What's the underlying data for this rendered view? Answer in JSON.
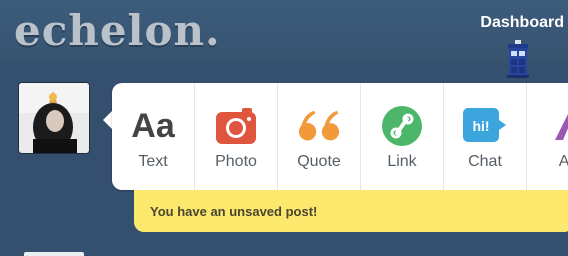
{
  "header": {
    "logo": "echelon.",
    "dashboard_label": "Dashboard"
  },
  "post_types": [
    {
      "label": "Text",
      "icon": "text-icon",
      "glyph": "Aa",
      "color": "#444444"
    },
    {
      "label": "Photo",
      "icon": "camera-icon",
      "color": "#e0553d"
    },
    {
      "label": "Quote",
      "icon": "quote-icon",
      "glyph": "❝",
      "color": "#f2993a"
    },
    {
      "label": "Link",
      "icon": "link-icon",
      "color": "#4cb76b"
    },
    {
      "label": "Chat",
      "icon": "chat-icon",
      "glyph": "hi!",
      "color": "#3ca5dd"
    },
    {
      "label": "Au",
      "icon": "audio-icon",
      "color": "#9b59b6"
    }
  ],
  "notice": {
    "text": "You have an unsaved post!"
  },
  "colors": {
    "background": "#34506e",
    "notice": "#fbe86c"
  }
}
